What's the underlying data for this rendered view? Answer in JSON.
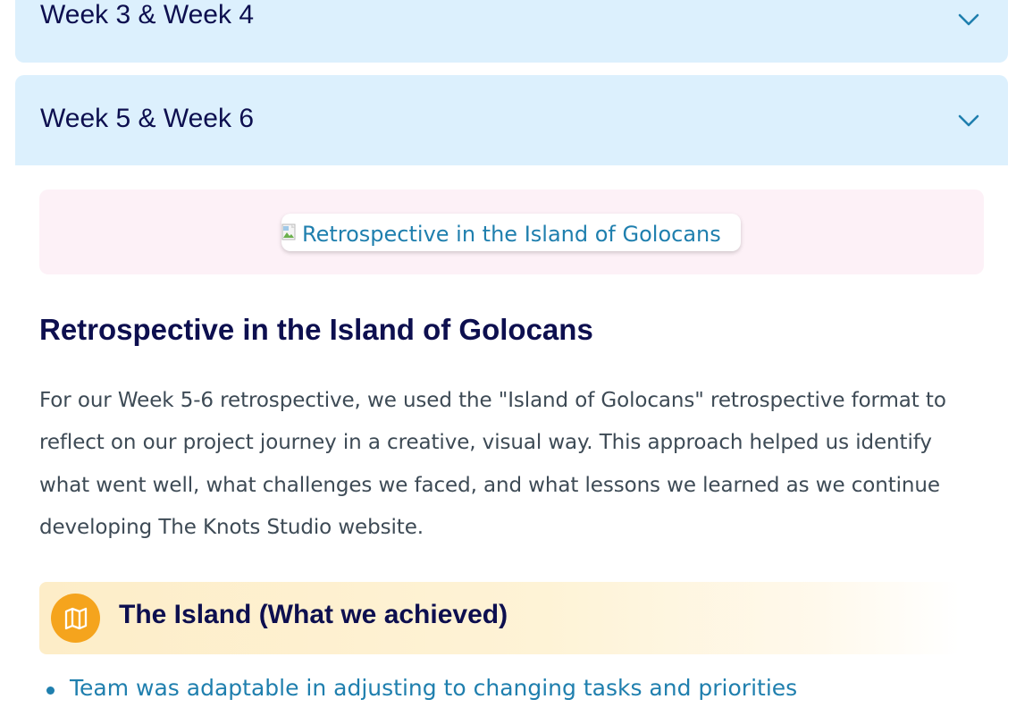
{
  "accordions": [
    {
      "title": "Week 3 & Week 4",
      "icon": "chevron-down-icon"
    },
    {
      "title": "Week 5 & Week 6",
      "icon": "chevron-down-icon"
    }
  ],
  "image": {
    "alt": "Retrospective in the Island of Golocans",
    "icon": "broken-image-icon"
  },
  "heading": "Retrospective in the Island of Golocans",
  "paragraph": "For our Week 5-6 retrospective, we used the \"Island of Golocans\" retrospective format to reflect on our project journey in a creative, visual way. This approach helped us identify what went well, what challenges we faced, and what lessons we learned as we continue developing The Knots Studio website.",
  "section": {
    "title": "The Island (What we achieved)",
    "icon": "map-icon"
  },
  "achievements": [
    "Team was adaptable in adjusting to changing tasks and priorities"
  ],
  "colors": {
    "accordion_bg": "#dcf0fd",
    "heading": "#0d0f4f",
    "link": "#1f7fae",
    "accent": "#f5a41d",
    "image_box_bg": "#fdf1f7"
  }
}
